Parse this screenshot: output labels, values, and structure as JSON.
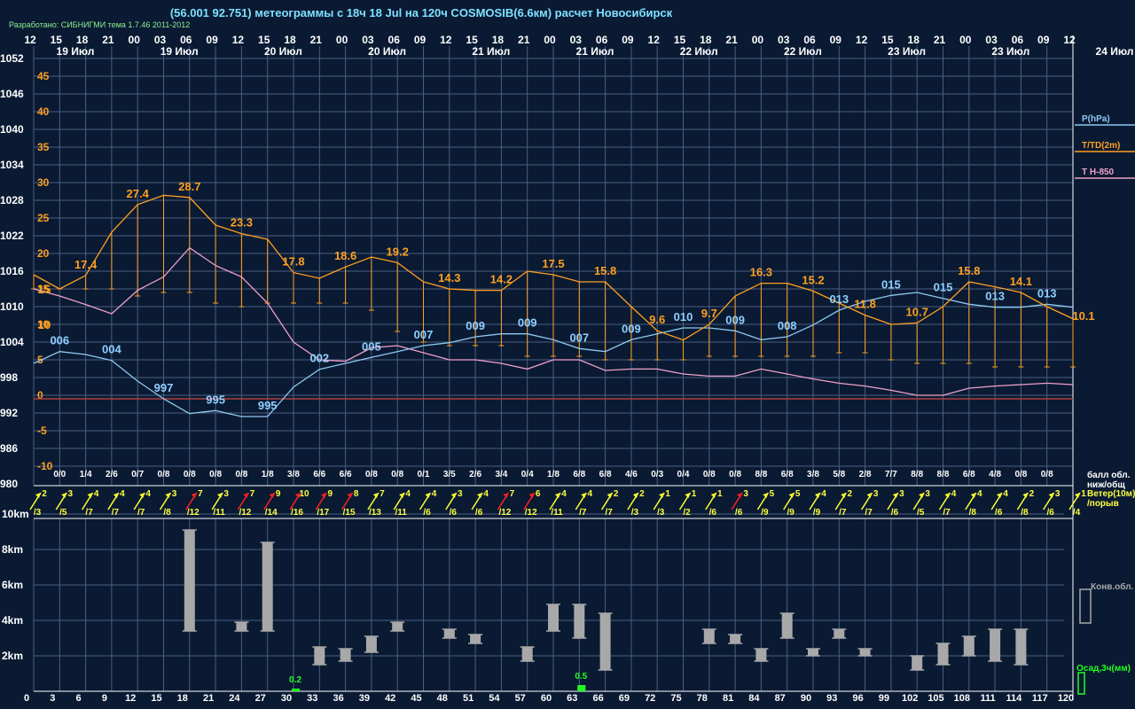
{
  "title": "(56.001 92.751) метеограммы с  18ч 18 Jul на 120ч COSMOSIB(6.6км) расчет Новосибирск",
  "credit": "Разработано: СИБНИГМИ тема 1.7.46 2011-2012",
  "colors": {
    "background": "#0a1a33",
    "grid": "#4a5f80",
    "pressure": "#8fc8f0",
    "temp": "#ffa020",
    "t850": "#f0a0c8",
    "zero": "#b04040",
    "wind_yellow": "#ffff30",
    "wind_red": "#ff2020",
    "cloud_bar": "#a8a8a8",
    "precip": "#20ff20"
  },
  "hour_labels": [
    "12",
    "15",
    "18",
    "21",
    "00",
    "03",
    "06",
    "09",
    "12",
    "15",
    "18",
    "21",
    "00",
    "03",
    "06",
    "09",
    "12",
    "15",
    "18",
    "21",
    "00",
    "03",
    "06",
    "09",
    "12",
    "15",
    "18",
    "21",
    "00",
    "03",
    "06",
    "09",
    "12",
    "15",
    "18",
    "21",
    "00",
    "03",
    "06",
    "09",
    "12"
  ],
  "date_labels": [
    "19 Июл",
    "19 Июл",
    "20 Июл",
    "20 Июл",
    "21 Июл",
    "21 Июл",
    "22 Июл",
    "22 Июл",
    "23 Июл",
    "23 Июл",
    "24 Июл"
  ],
  "pressure_axis_labels": [
    "1052",
    "1046",
    "1040",
    "1034",
    "1028",
    "1022",
    "1016",
    "1010",
    "1004",
    "998",
    "992",
    "986",
    "980"
  ],
  "temp_axis_labels": [
    "45",
    "40",
    "35",
    "30",
    "25",
    "20",
    "15",
    "10",
    "5",
    "0",
    "-5",
    "-10"
  ],
  "legend": {
    "pressure": "P(hPa)",
    "temp": "T/TD(2m)",
    "t850": "T H-850",
    "clouds": "балл обл.",
    "clouds2": "ниж/общ",
    "wind": "Ветер(10м)",
    "wind2": "/порыв",
    "conv": "Конв.обл.",
    "precip": "Осад,3ч(мм)"
  },
  "height_axis_labels": [
    "10km",
    "8km",
    "6km",
    "4km",
    "2km"
  ],
  "bottom_hour_labels": [
    "0",
    "3",
    "6",
    "9",
    "12",
    "15",
    "18",
    "21",
    "24",
    "27",
    "30",
    "33",
    "36",
    "39",
    "42",
    "45",
    "48",
    "51",
    "54",
    "57",
    "60",
    "63",
    "66",
    "69",
    "72",
    "75",
    "78",
    "81",
    "84",
    "87",
    "90",
    "93",
    "96",
    "99",
    "102",
    "105",
    "108",
    "111",
    "114",
    "117",
    "120"
  ],
  "chart_data": {
    "type": "line",
    "x_hours": [
      0,
      3,
      6,
      9,
      12,
      15,
      18,
      21,
      24,
      27,
      30,
      33,
      36,
      39,
      42,
      45,
      48,
      51,
      54,
      57,
      60,
      63,
      66,
      69,
      72,
      75,
      78,
      81,
      84,
      87,
      90,
      93,
      96,
      99,
      102,
      105,
      108,
      111,
      114,
      117,
      120
    ],
    "pressure_range": [
      980,
      1052
    ],
    "temp_range": [
      -10,
      45
    ],
    "series": [
      {
        "name": "P(hPa)",
        "values": [
          1004,
          1006,
          1005.5,
          1004.5,
          1001,
          998,
          995.5,
          996,
          995,
          995,
          1000,
          1003,
          1004,
          1005,
          1006,
          1007,
          1007.5,
          1008.5,
          1009,
          1009,
          1008,
          1006.5,
          1006,
          1008,
          1009,
          1010,
          1010,
          1009.5,
          1008,
          1008.5,
          1010.5,
          1013,
          1014.5,
          1015.5,
          1016,
          1015,
          1014,
          1013.5,
          1013.5,
          1014,
          1013.5
        ]
      },
      {
        "name": "T/TD(2m)",
        "values": [
          17.5,
          15.5,
          17.4,
          23.5,
          27.4,
          28.7,
          28.4,
          24.5,
          23.3,
          22.5,
          17.8,
          17,
          18.6,
          20,
          19.2,
          16.5,
          15.5,
          15.3,
          15.3,
          18,
          17.5,
          16.5,
          16.5,
          13,
          9.6,
          8.3,
          10.5,
          14.5,
          16.3,
          16.3,
          15.2,
          13.5,
          11.8,
          10.5,
          10.7,
          13,
          16.5,
          15.8,
          15,
          13,
          11.3
        ]
      },
      {
        "name": "dewpoint",
        "values": [
          15.5,
          15.5,
          15.5,
          15.5,
          14.5,
          15,
          15,
          13.5,
          13,
          13.5,
          13.5,
          13.5,
          13.5,
          12.5,
          9.5,
          8,
          7.5,
          7.5,
          7.5,
          6,
          6,
          6,
          5.5,
          5.5,
          5.5,
          5.5,
          6,
          6,
          6,
          6,
          6,
          6.5,
          6.5,
          5.5,
          5,
          5,
          5,
          4.5,
          4.5,
          4.5,
          4.5
        ]
      },
      {
        "name": "T H-850",
        "values": [
          15.5,
          14.5,
          13.3,
          12,
          15.3,
          17.2,
          21.3,
          18.8,
          17.2,
          13.5,
          8,
          5.5,
          5.3,
          7.2,
          7.5,
          6.5,
          5.5,
          5.5,
          5,
          4.2,
          5.5,
          5.5,
          4,
          4.2,
          4.2,
          3.5,
          3.2,
          3.2,
          4.2,
          3.5,
          2.8,
          2.2,
          1.8,
          1.2,
          0.5,
          0.5,
          1.5,
          1.8,
          2,
          2.2,
          2
        ]
      }
    ],
    "temp_labels": [
      {
        "h": 6,
        "v": "17.4"
      },
      {
        "h": 12,
        "v": "27.4"
      },
      {
        "h": 18,
        "v": "28.7"
      },
      {
        "h": 24,
        "v": "23.3"
      },
      {
        "h": 30,
        "v": "17.8"
      },
      {
        "h": 36,
        "v": "18.6"
      },
      {
        "h": 42,
        "v": "19.2"
      },
      {
        "h": 48,
        "v": "14.3"
      },
      {
        "h": 54,
        "v": "14.2"
      },
      {
        "h": 60,
        "v": "17.5"
      },
      {
        "h": 66,
        "v": "15.8"
      },
      {
        "h": 72,
        "v": "9.6"
      },
      {
        "h": 78,
        "v": "9.7"
      },
      {
        "h": 84,
        "v": "16.3"
      },
      {
        "h": 90,
        "v": "15.2"
      },
      {
        "h": 96,
        "v": "11.8"
      },
      {
        "h": 102,
        "v": "10.7"
      },
      {
        "h": 108,
        "v": "15.8"
      },
      {
        "h": 114,
        "v": "14.1"
      },
      {
        "h": 120,
        "v": "10.1"
      },
      {
        "h": 0,
        "v": "15"
      },
      {
        "h": 0,
        "v": "10"
      }
    ],
    "pressure_labels": [
      {
        "h": 3,
        "v": "006"
      },
      {
        "h": 9,
        "v": "004"
      },
      {
        "h": 15,
        "v": "997"
      },
      {
        "h": 21,
        "v": "995"
      },
      {
        "h": 27,
        "v": "995"
      },
      {
        "h": 33,
        "v": "002"
      },
      {
        "h": 39,
        "v": "005"
      },
      {
        "h": 45,
        "v": "007"
      },
      {
        "h": 51,
        "v": "009"
      },
      {
        "h": 57,
        "v": "009"
      },
      {
        "h": 63,
        "v": "007"
      },
      {
        "h": 69,
        "v": "009"
      },
      {
        "h": 75,
        "v": "010"
      },
      {
        "h": 81,
        "v": "009"
      },
      {
        "h": 87,
        "v": "008"
      },
      {
        "h": 93,
        "v": "013"
      },
      {
        "h": 99,
        "v": "015"
      },
      {
        "h": 105,
        "v": "015"
      },
      {
        "h": 111,
        "v": "013"
      },
      {
        "h": 117,
        "v": "013"
      }
    ],
    "cloud_fractions": [
      "0/0",
      "1/4",
      "2/6",
      "0/7",
      "0/8",
      "0/8",
      "0/8",
      "0/8",
      "1/8",
      "3/8",
      "6/6",
      "6/6",
      "0/8",
      "0/8",
      "0/1",
      "3/5",
      "2/6",
      "3/4",
      "0/4",
      "1/8",
      "6/8",
      "6/8",
      "4/6",
      "0/3",
      "0/4",
      "0/8",
      "0/8",
      "8/8",
      "6/8",
      "3/8",
      "5/8",
      "2/8",
      "7/7",
      "8/8",
      "8/8",
      "6/8",
      "4/8",
      "0/8",
      "0/8"
    ],
    "wind": [
      {
        "s": "2",
        "g": "/3",
        "c": "y"
      },
      {
        "s": "3",
        "g": "/5",
        "c": "y"
      },
      {
        "s": "4",
        "g": "/7",
        "c": "y"
      },
      {
        "s": "4",
        "g": "/7",
        "c": "y"
      },
      {
        "s": "4",
        "g": "/7",
        "c": "y"
      },
      {
        "s": "3",
        "g": "/8",
        "c": "y"
      },
      {
        "s": "7",
        "g": "/12",
        "c": "r"
      },
      {
        "s": "3",
        "g": "/11",
        "c": "y"
      },
      {
        "s": "7",
        "g": "/12",
        "c": "r"
      },
      {
        "s": "9",
        "g": "/14",
        "c": "r"
      },
      {
        "s": "10",
        "g": "/16",
        "c": "r"
      },
      {
        "s": "9",
        "g": "/17",
        "c": "r"
      },
      {
        "s": "8",
        "g": "/15",
        "c": "r"
      },
      {
        "s": "7",
        "g": "/13",
        "c": "y"
      },
      {
        "s": "4",
        "g": "/11",
        "c": "y"
      },
      {
        "s": "4",
        "g": "/6",
        "c": "y"
      },
      {
        "s": "3",
        "g": "/6",
        "c": "y"
      },
      {
        "s": "4",
        "g": "/6",
        "c": "y"
      },
      {
        "s": "7",
        "g": "/12",
        "c": "r"
      },
      {
        "s": "6",
        "g": "/12",
        "c": "r"
      },
      {
        "s": "4",
        "g": "/11",
        "c": "y"
      },
      {
        "s": "4",
        "g": "/7",
        "c": "y"
      },
      {
        "s": "2",
        "g": "/7",
        "c": "y"
      },
      {
        "s": "2",
        "g": "/3",
        "c": "y"
      },
      {
        "s": "1",
        "g": "/3",
        "c": "y"
      },
      {
        "s": "1",
        "g": "/2",
        "c": "y"
      },
      {
        "s": "1",
        "g": "/6",
        "c": "y"
      },
      {
        "s": "3",
        "g": "/6",
        "c": "r"
      },
      {
        "s": "5",
        "g": "/9",
        "c": "y"
      },
      {
        "s": "5",
        "g": "/9",
        "c": "y"
      },
      {
        "s": "4",
        "g": "/9",
        "c": "y"
      },
      {
        "s": "2",
        "g": "/7",
        "c": "y"
      },
      {
        "s": "3",
        "g": "/7",
        "c": "y"
      },
      {
        "s": "3",
        "g": "/6",
        "c": "y"
      },
      {
        "s": "3",
        "g": "/5",
        "c": "y"
      },
      {
        "s": "4",
        "g": "/7",
        "c": "y"
      },
      {
        "s": "4",
        "g": "/8",
        "c": "y"
      },
      {
        "s": "4",
        "g": "/6",
        "c": "y"
      },
      {
        "s": "2",
        "g": "/8",
        "c": "y"
      },
      {
        "s": "3",
        "g": "/6",
        "c": "y"
      },
      {
        "s": "1",
        "g": "/4",
        "c": "y"
      }
    ],
    "convective_clouds_km": [
      {
        "h": 18,
        "b": 3.4,
        "t": 9.1
      },
      {
        "h": 24,
        "b": 3.4,
        "t": 3.9
      },
      {
        "h": 27,
        "b": 3.4,
        "t": 8.4
      },
      {
        "h": 33,
        "b": 1.5,
        "t": 2.5
      },
      {
        "h": 36,
        "b": 1.7,
        "t": 2.4
      },
      {
        "h": 39,
        "b": 2.2,
        "t": 3.1
      },
      {
        "h": 42,
        "b": 3.4,
        "t": 3.9
      },
      {
        "h": 48,
        "b": 3.0,
        "t": 3.5
      },
      {
        "h": 51,
        "b": 2.7,
        "t": 3.2
      },
      {
        "h": 57,
        "b": 1.7,
        "t": 2.5
      },
      {
        "h": 60,
        "b": 3.4,
        "t": 4.9
      },
      {
        "h": 63,
        "b": 3.0,
        "t": 4.9
      },
      {
        "h": 66,
        "b": 1.2,
        "t": 4.4
      },
      {
        "h": 78,
        "b": 2.7,
        "t": 3.5
      },
      {
        "h": 81,
        "b": 2.7,
        "t": 3.2
      },
      {
        "h": 84,
        "b": 1.7,
        "t": 2.4
      },
      {
        "h": 87,
        "b": 3.0,
        "t": 4.4
      },
      {
        "h": 90,
        "b": 2.0,
        "t": 2.4
      },
      {
        "h": 93,
        "b": 3.0,
        "t": 3.5
      },
      {
        "h": 96,
        "b": 2.0,
        "t": 2.4
      },
      {
        "h": 102,
        "b": 1.2,
        "t": 2.0
      },
      {
        "h": 105,
        "b": 1.5,
        "t": 2.7
      },
      {
        "h": 108,
        "b": 2.0,
        "t": 3.1
      },
      {
        "h": 111,
        "b": 1.7,
        "t": 3.5
      },
      {
        "h": 114,
        "b": 1.5,
        "t": 3.5
      }
    ],
    "precip_mm": [
      {
        "h": 30,
        "v": "0.2",
        "mm": 0.2
      },
      {
        "h": 63,
        "v": "0.5",
        "mm": 0.5
      }
    ]
  }
}
